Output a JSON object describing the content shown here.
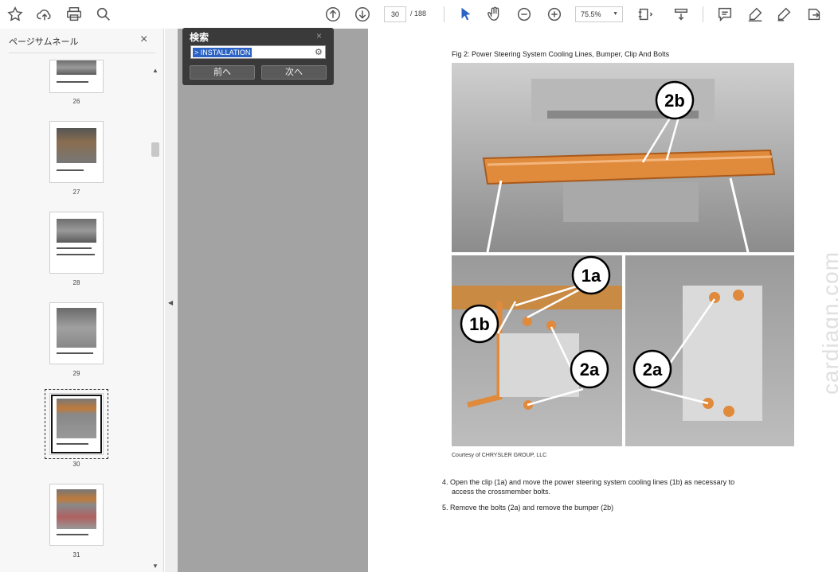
{
  "toolbar": {
    "page_current": "30",
    "page_total": "/ 188",
    "zoom": "75.5%"
  },
  "panel": {
    "title": "ページサムネール",
    "close": "×"
  },
  "thumbnails": [
    {
      "label": "26"
    },
    {
      "label": "27"
    },
    {
      "label": "28"
    },
    {
      "label": "29"
    },
    {
      "label": "30"
    },
    {
      "label": "31"
    }
  ],
  "search": {
    "title": "検索",
    "close": "×",
    "value": "> INSTALLATION",
    "prev_label": "前へ",
    "next_label": "次へ"
  },
  "doc": {
    "fig_caption": "Fig 2: Power Steering System Cooling Lines, Bumper, Clip And Bolts",
    "callouts": {
      "c2b": "2b",
      "c1a": "1a",
      "c1b": "1b",
      "c2a_left": "2a",
      "c2a_right": "2a"
    },
    "courtesy": "Courtesy of CHRYSLER GROUP, LLC",
    "step4_line1": "4. Open the clip (1a) and move the power steering system cooling lines (1b) as necessary to",
    "step4_line2": "access the crossmember bolts.",
    "step5": "5. Remove the bolts (2a) and remove the bumper (2b)",
    "watermark": "cardiagn.com"
  }
}
